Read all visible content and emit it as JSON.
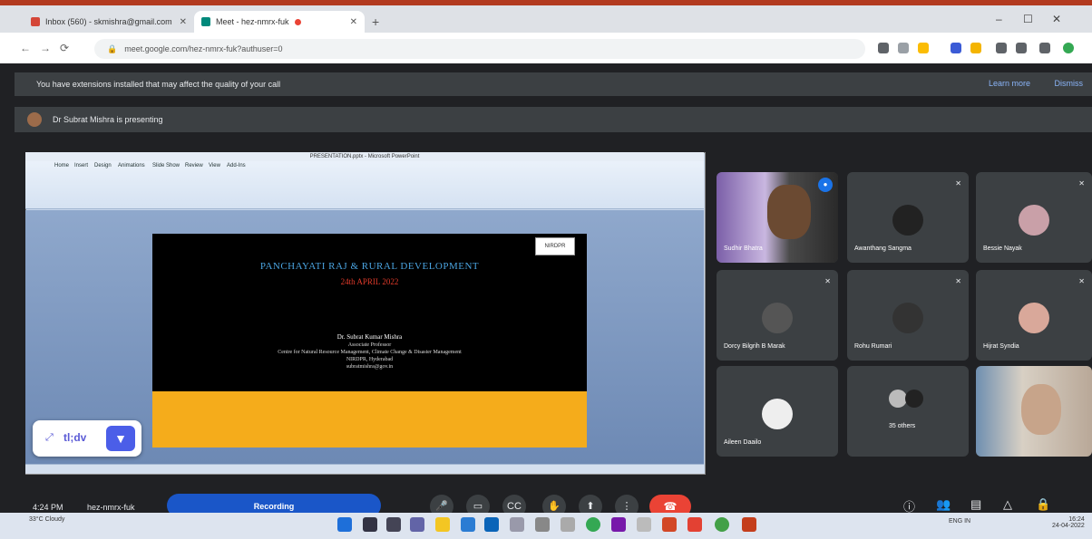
{
  "browser": {
    "tabs": [
      {
        "title": "Inbox (560) - skmishra@gmail.com"
      },
      {
        "title": "Meet - hez-nmrx-fuk"
      }
    ],
    "new_tab_glyph": "+",
    "window_controls": {
      "minimize": "–",
      "maximize": "☐",
      "close": "✕"
    },
    "url": "meet.google.com/hez-nmrx-fuk?authuser=0",
    "nav": {
      "back": "←",
      "forward": "→",
      "reload": "⟳"
    }
  },
  "meet": {
    "warning": {
      "text": "You have extensions installed that may affect the quality of your call",
      "learn_more": "Learn more",
      "dismiss": "Dismiss"
    },
    "presenting": "Dr Subrat Mishra is presenting",
    "slide": {
      "window_title": "PRESENTATION.pptx - Microsoft PowerPoint",
      "ribbon_tabs": [
        "Home",
        "Insert",
        "Design",
        "Animations",
        "Slide Show",
        "Review",
        "View",
        "Add-Ins"
      ],
      "logo": "NIRDPR",
      "title": "PANCHAYATI RAJ & RURAL DEVELOPMENT",
      "date": "24th APRIL 2022",
      "name": "Dr. Subrat Kumar Mishra",
      "role": "Associate Professor",
      "inst": "Centre for Natural Resource Management, Climate Change & Disaster Management",
      "org": "NIRDPR, Hyderabad",
      "email": "subratmishra@gov.in"
    },
    "tldv": {
      "label": "tl;dv",
      "expand_icon": "⤢",
      "pin_icon": "📌"
    },
    "participants": [
      {
        "name": "Sudhir Bhatra",
        "video": true
      },
      {
        "name": "Awanthang Sangma",
        "video": false
      },
      {
        "name": "Bessie Nayak",
        "video": false
      },
      {
        "name": "Dorcy Bilgrih B Marak",
        "video": false
      },
      {
        "name": "Rohu Rumari",
        "video": false
      },
      {
        "name": "Hijrat Syndia",
        "video": false
      },
      {
        "name": "Aileen Daailo",
        "video": false
      },
      {
        "name": "35 others",
        "video": false
      },
      {
        "name": "",
        "video": true
      }
    ],
    "controls": {
      "time": "4:24 PM",
      "meeting_code": "hez-nmrx-fuk",
      "recording": "Recording",
      "buttons": [
        "mic-icon",
        "camera-icon",
        "captions-icon",
        "raise-hand-icon",
        "present-icon",
        "more-icon"
      ],
      "end_icon": "phone-hangup-icon"
    }
  },
  "taskbar": {
    "weather": "33°C Cloudy",
    "sys": "ENG IN",
    "clock_time": "16:24",
    "clock_date": "24-04-2022"
  },
  "colors": {
    "accent": "#1a56c8",
    "end_call": "#ea4335",
    "slide_title": "#4aa3df",
    "slide_date": "#e03a2a",
    "slide_band": "#f5ac1b"
  }
}
